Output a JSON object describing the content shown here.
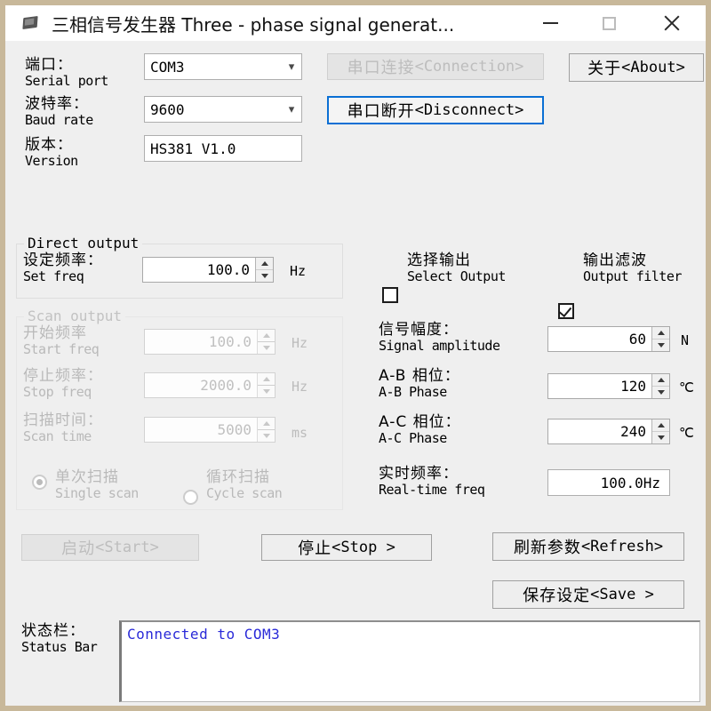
{
  "window": {
    "title": "三相信号发生器 Three - phase signal generat...",
    "icon": "chip-icon",
    "minimize_icon": "minimize-icon",
    "maximize_icon": "maximize-icon",
    "close_icon": "close-icon",
    "border_color": "#c8b89a",
    "body_color": "#efefef"
  },
  "connection": {
    "serial_port": {
      "label_cn": "端口：",
      "label_en": "Serial port",
      "value": "COM3",
      "arrow_icon": "chevron-down-icon"
    },
    "baud_rate": {
      "label_cn": "波特率：",
      "label_en": "Baud rate",
      "value": "9600",
      "arrow_icon": "chevron-down-icon"
    },
    "version": {
      "label_cn": "版本：",
      "label_en": "Version",
      "value": "HS381 V1.0"
    },
    "connect_button": {
      "cn": "串口连接",
      "en": "<Connection>",
      "enabled": false
    },
    "disconnect_button": {
      "cn": "串口断开",
      "en": "<Disconnect>",
      "enabled": true,
      "focused": true
    },
    "about_button": {
      "cn": "关于",
      "en": "<About>",
      "enabled": true
    }
  },
  "direct_output": {
    "legend": "Direct output",
    "set_freq": {
      "label_cn": "设定频率：",
      "label_en": "Set freq",
      "value": "100.0",
      "unit": "Hz"
    }
  },
  "scan_output": {
    "legend": "Scan output",
    "enabled": false,
    "start_freq": {
      "label_cn": "开始频率",
      "label_en": "Start freq",
      "value": "100.0",
      "unit": "Hz"
    },
    "stop_freq": {
      "label_cn": "停止频率：",
      "label_en": "Stop freq",
      "value": "2000.0",
      "unit": "Hz"
    },
    "scan_time": {
      "label_cn": "扫描时间：",
      "label_en": "Scan time",
      "value": "5000",
      "unit": "ms"
    },
    "single_scan": {
      "label_cn": "单次扫描",
      "label_en": "Single scan",
      "selected": true
    },
    "cycle_scan": {
      "label_cn": "循环扫描",
      "label_en": "Cycle scan",
      "selected": false
    }
  },
  "options": {
    "select_output": {
      "label_cn": "选择输出",
      "label_en": "Select Output",
      "checked": false
    },
    "output_filter": {
      "label_cn": "输出滤波",
      "label_en": "Output filter",
      "checked": true
    }
  },
  "signal": {
    "amplitude": {
      "label_cn": "信号幅度：",
      "label_en": "Signal amplitude",
      "value": "60",
      "unit": "N"
    },
    "ab_phase": {
      "label_cn": "A-B 相位：",
      "label_en": "A-B Phase",
      "value": "120",
      "unit": "℃"
    },
    "ac_phase": {
      "label_cn": "A-C 相位：",
      "label_en": "A-C Phase",
      "value": "240",
      "unit": "℃"
    },
    "realtime_freq": {
      "label_cn": "实时频率：",
      "label_en": "Real-time freq",
      "value": "100.0Hz"
    }
  },
  "actions": {
    "start": {
      "cn": "启动",
      "en": "<Start>",
      "enabled": false
    },
    "stop": {
      "cn": "停止",
      "en": "<Stop >",
      "enabled": true
    },
    "refresh": {
      "cn": "刷新参数",
      "en": "<Refresh>",
      "enabled": true
    },
    "save": {
      "cn": "保存设定",
      "en": "<Save >",
      "enabled": true
    }
  },
  "status": {
    "label_cn": "状态栏：",
    "label_en": "Status Bar",
    "text_color": "#2a2ad8",
    "lines": [
      "Connected to COM3"
    ]
  }
}
